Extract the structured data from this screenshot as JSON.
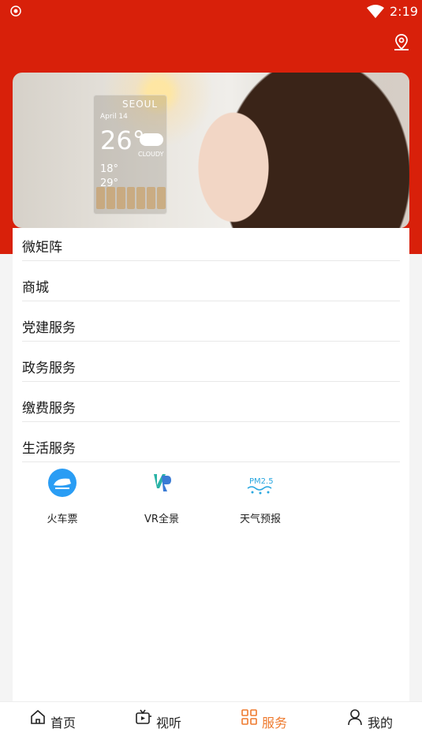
{
  "status_bar": {
    "time": "2:19"
  },
  "header": {
    "location_icon": "location-pin-icon"
  },
  "banner": {
    "image_alt": "weather advertisement",
    "weather": {
      "city": "SEOUL",
      "date": "April 14",
      "temperature": "26°",
      "condition": "CLOUDY",
      "low": "18°",
      "high": "29°"
    }
  },
  "categories": [
    {
      "label": "微矩阵"
    },
    {
      "label": "商城"
    },
    {
      "label": "党建服务"
    },
    {
      "label": "政务服务"
    },
    {
      "label": "缴费服务"
    },
    {
      "label": "生活服务"
    }
  ],
  "services": [
    {
      "label": "火车票",
      "icon": "train-icon",
      "color": "#2a9df4"
    },
    {
      "label": "VR全景",
      "icon": "vr-icon",
      "color": "#3a7bd5"
    },
    {
      "label": "天气预报",
      "icon": "pm25-weather-icon",
      "color": "#2aa7e0"
    }
  ],
  "tabs": [
    {
      "label": "首页",
      "icon": "home-icon",
      "active": false
    },
    {
      "label": "视听",
      "icon": "tv-icon",
      "active": false
    },
    {
      "label": "服务",
      "icon": "grid-icon",
      "active": true
    },
    {
      "label": "我的",
      "icon": "user-icon",
      "active": false
    }
  ],
  "colors": {
    "brand": "#d8200a",
    "active_tab": "#ee7a2e"
  }
}
